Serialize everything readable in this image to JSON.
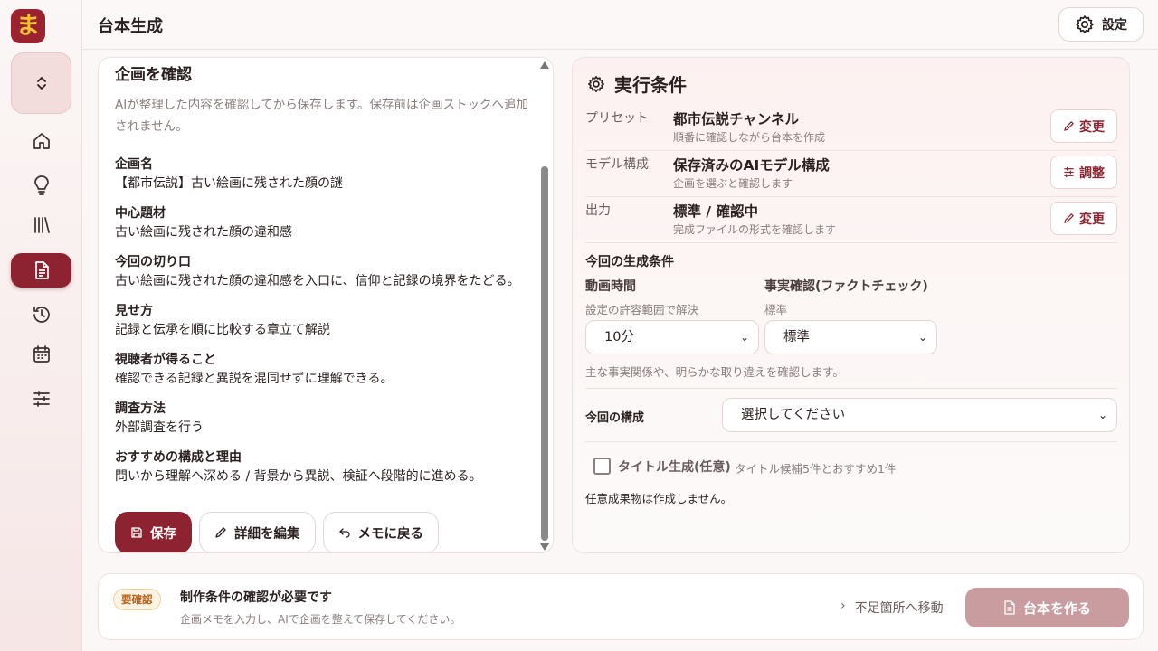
{
  "app": {
    "logo_char": "ま",
    "page_title": "台本生成",
    "settings_label": "設定"
  },
  "sidebar": {
    "items": [
      {
        "name": "home",
        "icon": "home-icon"
      },
      {
        "name": "ideas",
        "icon": "lightbulb-icon"
      },
      {
        "name": "library",
        "icon": "library-icon"
      },
      {
        "name": "script",
        "icon": "document-icon",
        "active": true
      },
      {
        "name": "history",
        "icon": "history-icon"
      },
      {
        "name": "calendar",
        "icon": "calendar-icon"
      },
      {
        "name": "settings",
        "icon": "sliders-icon"
      }
    ]
  },
  "plan": {
    "title": "企画を確認",
    "description": "AIが整理した内容を確認してから保存します。保存前は企画ストックへ追加されません。",
    "fields": [
      {
        "label": "企画名",
        "value": "【都市伝説】古い絵画に残された顔の謎"
      },
      {
        "label": "中心題材",
        "value": "古い絵画に残された顔の違和感"
      },
      {
        "label": "今回の切り口",
        "value": "古い絵画に残された顔の違和感を入口に、信仰と記録の境界をたどる。"
      },
      {
        "label": "見せ方",
        "value": "記録と伝承を順に比較する章立て解説"
      },
      {
        "label": "視聴者が得ること",
        "value": "確認できる記録と異説を混同せずに理解できる。"
      },
      {
        "label": "調査方法",
        "value": "外部調査を行う"
      },
      {
        "label": "おすすめの構成と理由",
        "value": "問いから理解へ深める / 背景から異説、検証へ段階的に進める。"
      }
    ],
    "buttons": {
      "save": "保存",
      "edit": "詳細を編集",
      "back": "メモに戻る"
    }
  },
  "conditions": {
    "title": "実行条件",
    "rows": [
      {
        "label": "プリセット",
        "main": "都市伝説チャンネル",
        "sub": "順番に確認しながら台本を作成",
        "button": "変更"
      },
      {
        "label": "モデル構成",
        "main": "保存済みのAIモデル構成",
        "sub": "企画を選ぶと確認します",
        "button": "調整"
      },
      {
        "label": "出力",
        "main": "標準 / 確認中",
        "sub": "完成ファイルの形式を確認します",
        "button": "変更"
      }
    ],
    "gen_heading": "今回の生成条件",
    "duration": {
      "label": "動画時間",
      "hint": "設定の許容範囲で解決",
      "value": "10分"
    },
    "factcheck": {
      "label": "事実確認(ファクトチェック)",
      "hint": "標準",
      "value": "標準"
    },
    "factcheck_note": "主な事実関係や、明らかな取り違えを確認します。",
    "structure": {
      "label": "今回の構成",
      "placeholder": "選択してください"
    },
    "title_gen": {
      "label": "タイトル生成(任意)",
      "hint": "タイトル候補5件とおすすめ1件"
    },
    "optional_note": "任意成果物は作成しません。"
  },
  "footer": {
    "badge": "要確認",
    "title": "制作条件の確認が必要です",
    "subtitle": "企画メモを入力し、AIで企画を整えて保存してください。",
    "jump": "不足箇所へ移動",
    "make_button": "台本を作る"
  }
}
